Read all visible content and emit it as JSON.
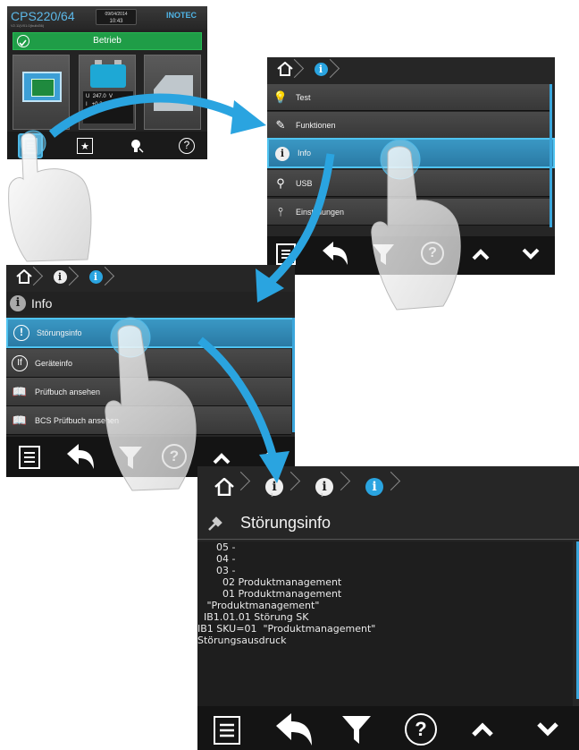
{
  "screen1": {
    "model": "CPS220/64",
    "firmware": "V2.11|V01.0(build36)",
    "date": "09/04/2014",
    "time": "10:43",
    "brand": "INOTEC",
    "status_label": "Betrieb",
    "readout": [
      {
        "sym": "U",
        "val": "247.0",
        "unit": "V"
      },
      {
        "sym": "I",
        "val": "+0.2",
        "unit": "A"
      },
      {
        "sym": "C",
        "val": "",
        "unit": ""
      }
    ]
  },
  "screen2": {
    "items": [
      {
        "label": "Test",
        "icon": "bulb-icon"
      },
      {
        "label": "Funktionen",
        "icon": "wrench-icon"
      },
      {
        "label": "Info",
        "icon": "info-icon"
      },
      {
        "label": "USB",
        "icon": "usb-icon"
      },
      {
        "label": "Einstellungen",
        "icon": "settings-icon"
      }
    ],
    "selected": "Info"
  },
  "screen3": {
    "crumb_sub": "1",
    "title": "Info",
    "items": [
      {
        "label": "Störungsinfo",
        "icon": "warning-icon"
      },
      {
        "label": "Geräteinfo",
        "icon": "device-info-icon"
      },
      {
        "label": "Prüfbuch ansehen",
        "icon": "book-icon"
      },
      {
        "label": "BCS Prüfbuch ansehen",
        "icon": "book-icon"
      }
    ],
    "selected": "Störungsinfo"
  },
  "screen4": {
    "crumb_subs": [
      "1",
      "1"
    ],
    "title": "Störungsinfo",
    "log_lines": [
      "      05 -",
      "      04 -",
      "      03 -",
      "        02 Produktmanagement",
      "        01 Produktmanagement",
      "   \"Produktmanagement\"",
      "  IB1.01.01 Störung SK",
      "IB1 SKU=01  \"Produktmanagement\"",
      "Störungsausdruck"
    ]
  },
  "colors": {
    "accent": "#2aa4e0",
    "status_ok": "#1f9d47",
    "panel_bg": "#262626",
    "arrow": "#2aa4e0"
  }
}
